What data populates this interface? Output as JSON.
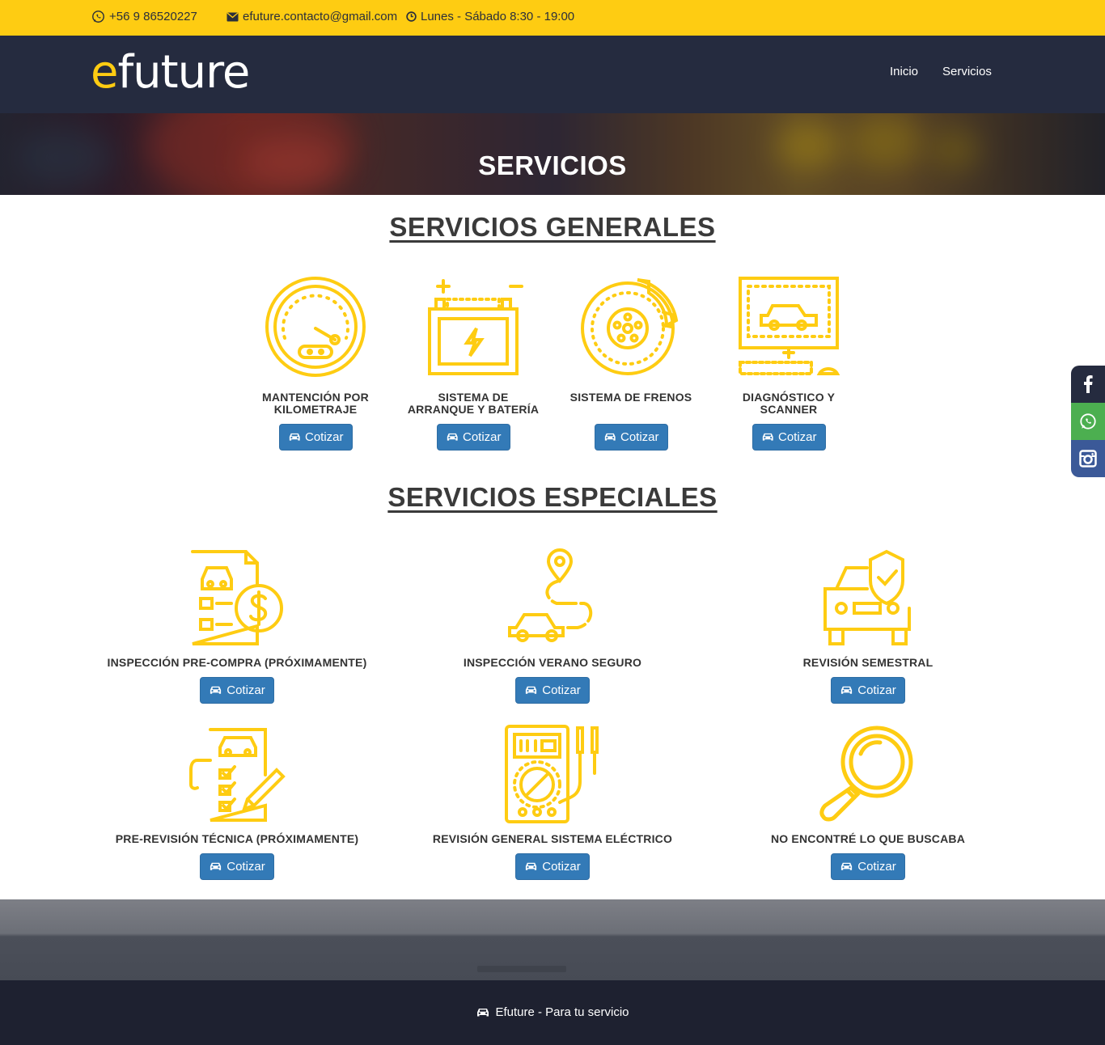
{
  "topbar": {
    "phone": "+56 9 86520227",
    "email": "efuture.contacto@gmail.com",
    "hours": "Lunes - Sábado 8:30 - 19:00"
  },
  "brand": {
    "logo_first": "e",
    "logo_rest": "future"
  },
  "nav": {
    "items": [
      "Inicio",
      "Servicios"
    ]
  },
  "hero": {
    "title": "SERVICIOS"
  },
  "general": {
    "title": "SERVICIOS GENERALES",
    "items": [
      {
        "label_line1": "MANTENCIÓN POR",
        "label_line2": "KILOMETRAJE",
        "button": "Cotizar",
        "icon": "speedometer-icon"
      },
      {
        "label_line1": "SISTEMA DE",
        "label_line2": "ARRANQUE Y BATERÍA",
        "button": "Cotizar",
        "icon": "battery-icon"
      },
      {
        "label_line1": "SISTEMA DE FRENOS",
        "label_line2": "",
        "button": "Cotizar",
        "icon": "brake-disc-icon"
      },
      {
        "label_line1": "DIAGNÓSTICO Y",
        "label_line2": "SCANNER",
        "button": "Cotizar",
        "icon": "diagnostic-computer-icon"
      }
    ]
  },
  "special": {
    "title": "SERVICIOS ESPECIALES",
    "items": [
      {
        "label": "INSPECCIÓN PRE-COMPRA (PRÓXIMAMENTE)",
        "button": "Cotizar",
        "icon": "car-invoice-icon"
      },
      {
        "label": "INSPECCIÓN VERANO SEGURO",
        "button": "Cotizar",
        "icon": "car-route-icon"
      },
      {
        "label": "REVISIÓN SEMESTRAL",
        "button": "Cotizar",
        "icon": "car-shield-icon"
      },
      {
        "label": "PRE-REVISIÓN TÉCNICA (PRÓXIMAMENTE)",
        "button": "Cotizar",
        "icon": "checklist-icon"
      },
      {
        "label": "REVISIÓN GENERAL SISTEMA ELÉCTRICO",
        "button": "Cotizar",
        "icon": "multimeter-icon"
      },
      {
        "label": "NO ENCONTRÉ LO QUE BUSCABA",
        "button": "Cotizar",
        "icon": "magnifier-icon"
      }
    ]
  },
  "social": [
    "facebook-icon",
    "whatsapp-icon",
    "instagram-icon"
  ],
  "footer": {
    "text": "Efuture - Para tu servicio"
  },
  "colors": {
    "accent": "#fecc12",
    "navy": "#252b3f",
    "button": "#337ab7",
    "whatsapp": "#4caf50",
    "instagram": "#3b5998"
  }
}
